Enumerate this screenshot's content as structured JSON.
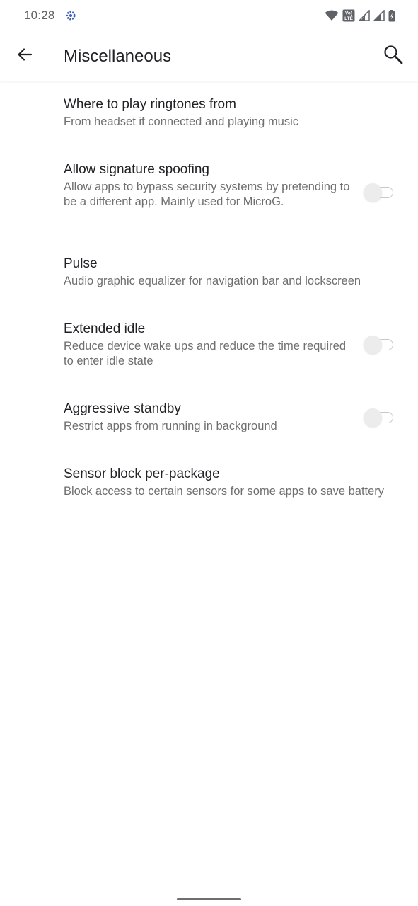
{
  "status_bar": {
    "time": "10:28",
    "volte_label_top": "Vo)",
    "volte_label_bottom": "LTE"
  },
  "app_bar": {
    "title": "Miscellaneous",
    "back_icon": "arrow-back-icon",
    "search_icon": "search-icon"
  },
  "preferences": [
    {
      "title": "Where to play ringtones from",
      "summary": "From headset if connected and playing music",
      "has_toggle": false
    },
    {
      "title": "Allow signature spoofing",
      "summary": "Allow apps to bypass security systems by pretending to be a different app. Mainly used for MicroG.",
      "has_toggle": true,
      "checked": false
    },
    {
      "title": "Pulse",
      "summary": "Audio graphic equalizer for navigation bar and lockscreen",
      "has_toggle": false
    },
    {
      "title": "Extended idle",
      "summary": "Reduce device wake ups and reduce the time required to enter idle state",
      "has_toggle": true,
      "checked": false
    },
    {
      "title": "Aggressive standby",
      "summary": "Restrict apps from running in background",
      "has_toggle": true,
      "checked": false
    },
    {
      "title": "Sensor block per-package",
      "summary": "Block access to certain sensors for some apps to save battery",
      "has_toggle": false
    }
  ]
}
